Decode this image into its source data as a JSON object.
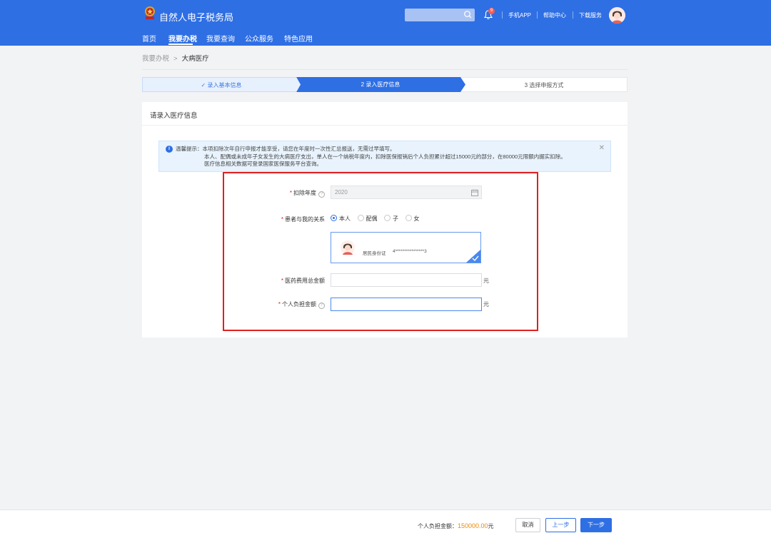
{
  "header": {
    "title": "自然人电子税务局",
    "search_placeholder": "",
    "notification_count": "9",
    "links": [
      "手机APP",
      "帮助中心",
      "下载服务"
    ],
    "brand_color": "#2f6fe4"
  },
  "nav": {
    "items": [
      "首页",
      "我要办税",
      "我要查询",
      "公众服务",
      "特色应用"
    ],
    "active": "我要办税"
  },
  "breadcrumb": {
    "parent": "我要办税",
    "current": "大病医疗"
  },
  "steps": [
    {
      "label": "✓ 录入基本信息",
      "state": "done"
    },
    {
      "label": "2 录入医疗信息",
      "state": "active"
    },
    {
      "label": "3 选择申报方式",
      "state": "todo"
    }
  ],
  "panel": {
    "title": "请录入医疗信息"
  },
  "tip": {
    "line1": "温馨提示：本项扣除次年自行申报才能享受，请您在年度时一次性汇总报送，无需过早填写。",
    "line2": "本人、配偶或未成年子女发生的大病医疗支出，单人在一个纳税年度内，扣除医保报销后个人负担累计超过15000元的部分，在80000元限额内据实扣除。",
    "line3": "医疗信息相关数据可登录国家医保服务平台查询。"
  },
  "form": {
    "year_label": "扣除年度",
    "year_value": "2020",
    "relation_label": "患者与我的关系",
    "relation_options": [
      "本人",
      "配偶",
      "子",
      "女"
    ],
    "relation_selected": "本人",
    "id_type": "居民身份证",
    "id_number": "4****************3",
    "total_label": "医药费用总金额",
    "total_value": "",
    "personal_label": "个人负担金额",
    "personal_value": "",
    "unit": "元"
  },
  "footer": {
    "summary_label": "个人负担金额：",
    "summary_amount": "150000.00",
    "summary_unit": "元",
    "cancel": "取消",
    "prev": "上一步",
    "next": "下一步"
  }
}
